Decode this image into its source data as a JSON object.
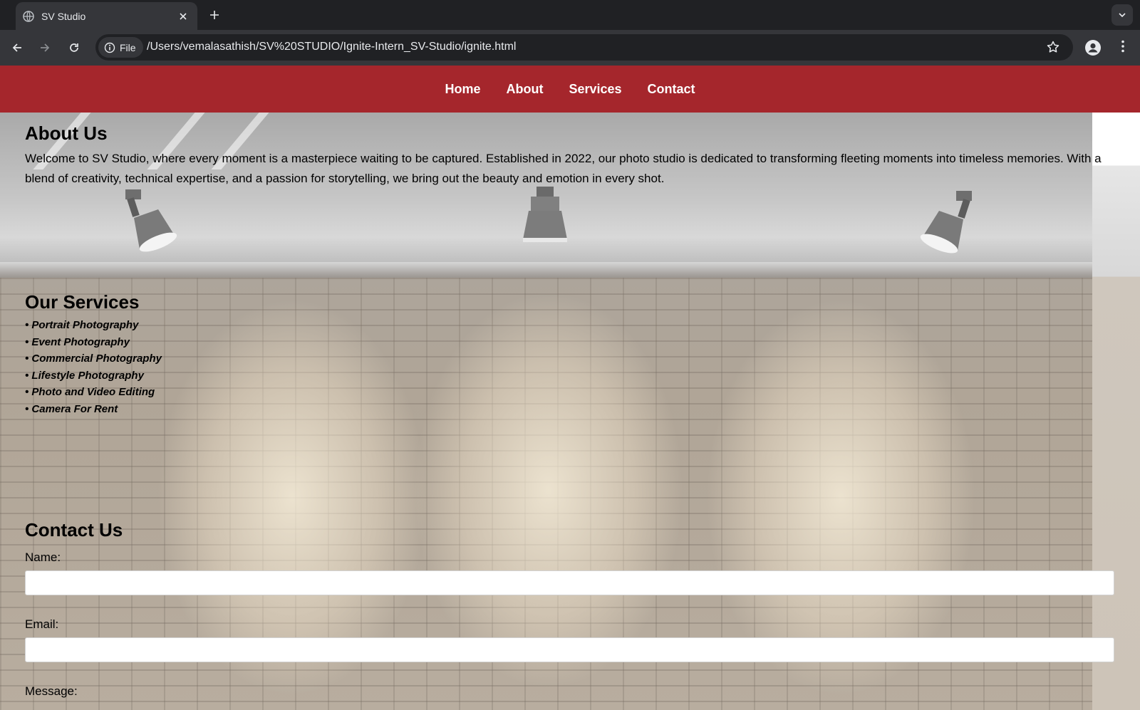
{
  "browser": {
    "tab_title": "SV Studio",
    "file_chip": "File",
    "url": "/Users/vemalasathish/SV%20STUDIO/Ignite-Intern_SV-Studio/ignite.html"
  },
  "nav": {
    "items": [
      "Home",
      "About",
      "Services",
      "Contact"
    ]
  },
  "about": {
    "title": "About Us",
    "text": "Welcome to SV Studio, where every moment is a masterpiece waiting to be captured. Established in 2022, our photo studio is dedicated to transforming fleeting moments into timeless memories. With a blend of creativity, technical expertise, and a passion for storytelling, we bring out the beauty and emotion in every shot."
  },
  "services": {
    "title": "Our Services",
    "items": [
      "• Portrait Photography",
      "• Event Photography",
      "• Commercial Photography",
      "• Lifestyle Photography",
      "• Photo and Video Editing",
      "• Camera For Rent"
    ]
  },
  "contact": {
    "title": "Contact Us",
    "name_label": "Name:",
    "email_label": "Email:",
    "message_label": "Message:"
  },
  "colors": {
    "nav_bg": "#a5262c",
    "chrome_dark": "#202124",
    "chrome_toolbar": "#35363a"
  }
}
